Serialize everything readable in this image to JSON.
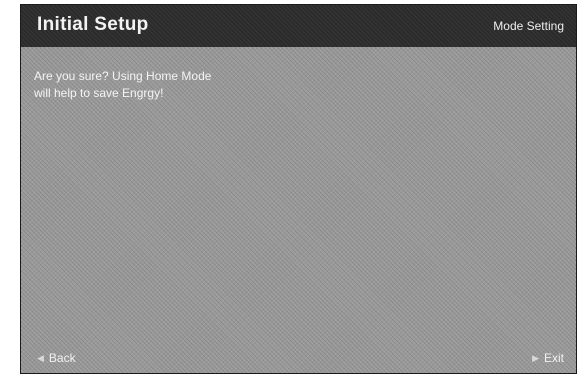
{
  "header": {
    "title": "Initial Setup",
    "mode_label": "Mode Setting"
  },
  "message": {
    "line1": "Are you sure? Using Home Mode",
    "line2": "will help to save Engrgy!"
  },
  "footer": {
    "back_label": "Back",
    "back_icon": "left-triangle-icon",
    "exit_label": "Exit",
    "exit_icon": "right-triangle-icon"
  },
  "colors": {
    "title_bar": "#2b2b2b",
    "background": "#9a9a9a",
    "text": "#f2f2f2"
  }
}
